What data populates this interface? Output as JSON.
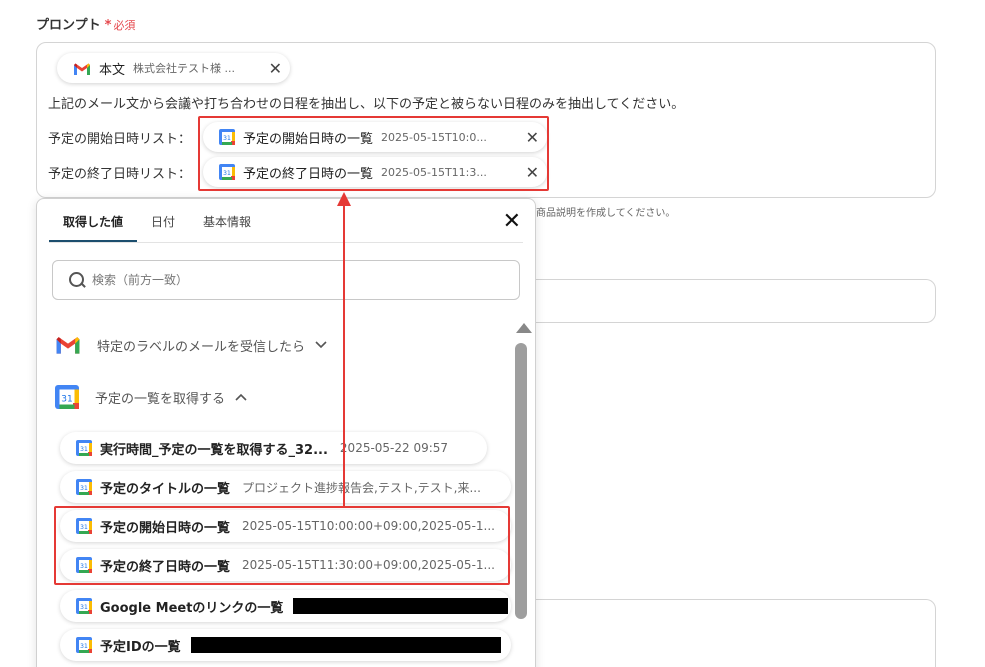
{
  "field": {
    "label": "プロンプト",
    "required_mark": "*",
    "required_text": "必須"
  },
  "prompt": {
    "chip_body": {
      "name": "本文",
      "value": "株式会社テスト様 ...",
      "icon": "gmail-icon"
    },
    "line1": "上記のメール文から会議や打ち合わせの日程を抽出し、以下の予定と被らない日程のみを抽出してください。",
    "start_label": "予定の開始日時リスト：",
    "end_label": "予定の終了日時リスト：",
    "chip_start": {
      "name": "予定の開始日時の一覧",
      "value": "2025-05-15T10:0...",
      "icon": "google-calendar-icon"
    },
    "chip_end": {
      "name": "予定の終了日時の一覧",
      "value": "2025-05-15T11:3...",
      "icon": "google-calendar-icon"
    },
    "close_glyph": "✕"
  },
  "hint": "商品説明を作成してください。",
  "panel": {
    "tabs": [
      {
        "label": "取得した値",
        "active": true
      },
      {
        "label": "日付",
        "active": false
      },
      {
        "label": "基本情報",
        "active": false
      }
    ],
    "close_glyph": "✕",
    "search_placeholder": "検索（前方一致）",
    "sections": [
      {
        "label": "特定のラベルのメールを受信したら",
        "icon": "gmail-icon",
        "chevron": "⌄"
      },
      {
        "label": "予定の一覧を取得する",
        "icon": "google-calendar-icon",
        "chevron": "⌃"
      }
    ],
    "items": [
      {
        "name": "実行時間_予定の一覧を取得する_32...",
        "value": "2025-05-22 09:57"
      },
      {
        "name": "予定のタイトルの一覧",
        "value": "プロジェクト進捗報告会,テスト,テスト,来..."
      },
      {
        "name": "予定の開始日時の一覧",
        "value": "2025-05-15T10:00:00+09:00,2025-05-1..."
      },
      {
        "name": "予定の終了日時の一覧",
        "value": "2025-05-15T11:30:00+09:00,2025-05-1..."
      },
      {
        "name": "Google Meetのリンクの一覧",
        "value": ""
      },
      {
        "name": "予定IDの一覧",
        "value": ""
      }
    ]
  },
  "colors": {
    "required": "#e5484d",
    "highlight": "#e53935",
    "tab_underline": "#1c4e6e"
  }
}
